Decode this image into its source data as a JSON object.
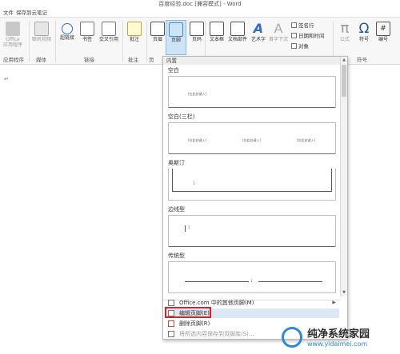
{
  "window": {
    "title": "百度经验.doc [兼容模式] - Word"
  },
  "tabs": {
    "file": "文件",
    "cloud": "保存到云笔记"
  },
  "ribbon": {
    "buttons": {
      "office": "Office",
      "apps": "应用程序",
      "online_media": "联机视频",
      "hyperlink": "超链接",
      "bookmark": "书签",
      "cross_reference": "交叉引用",
      "comment": "批注",
      "header": "页眉",
      "footer": "页脚",
      "page_number": "页码",
      "text_box": "文本框",
      "quick_parts": "文档部件",
      "wordart": "艺术字",
      "drop_cap": "首字下沉",
      "equation": "公式",
      "symbol": "符号",
      "number": "编号"
    },
    "small": {
      "signature": "签名行",
      "datetime": "日期和时间",
      "object": "对象"
    },
    "groups": {
      "apps": "应用程序",
      "media": "媒体",
      "links": "链接",
      "comments": "批注",
      "header_footer": "页",
      "symbols": "符号"
    }
  },
  "document": {
    "paragraph_mark": "↵"
  },
  "footer_gallery": {
    "header": "内置",
    "items": [
      {
        "name": "空白",
        "placeholder": "[在此处键入]"
      },
      {
        "name": "空白(三栏)",
        "placeholders": [
          "[在此处键入]",
          "[在此处键入]",
          "[在此处键入]"
        ]
      },
      {
        "name": "奥斯汀",
        "placeholder": "1"
      },
      {
        "name": "边线型",
        "placeholder": "1"
      },
      {
        "name": "传统型",
        "placeholder": "1"
      }
    ],
    "menu": {
      "more_footers": "Office.com 中的其他页脚(M)",
      "edit_footer": "编辑页脚(E)",
      "remove_footer": "删除页脚(R)",
      "save_selection": "将所选内容保存到页脚库(S)..."
    }
  },
  "watermark": {
    "title": "纯净系统家园",
    "url": "www.yidaimei.com"
  }
}
